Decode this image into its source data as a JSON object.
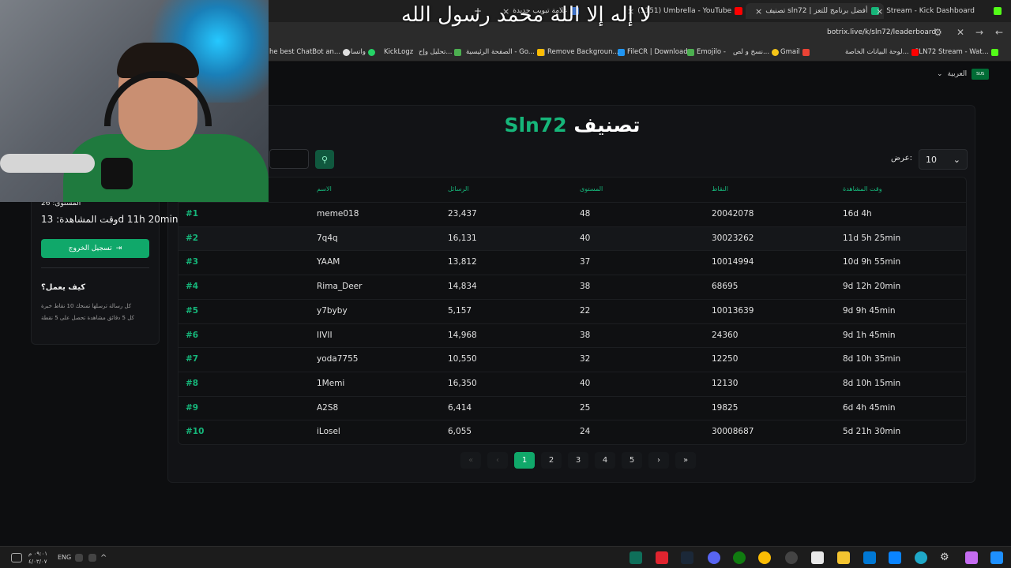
{
  "browser": {
    "tabs": [
      {
        "label": "علامة تبويب جديدة",
        "color": "#4c8bf5"
      },
      {
        "label": "(1151) Umbrella - YouTube",
        "color": "#ff0000"
      },
      {
        "label": "تصنيف sln72 | أفضل برنامج للتعز",
        "color": "#16b67a"
      },
      {
        "label": "Stream - Kick Dashboard",
        "color": "#53fc18"
      }
    ],
    "url": "botrix.live/k/sln72/leaderboard",
    "bookmarks": [
      "SLN72 Stream - Wat...",
      "لوحة البيانات الخاصة...",
      "Gmail",
      "نسخ و لص...",
      "Emojilo -",
      "FileCR | Download",
      "Remove Backgroun...",
      "الصفحة الرئيسية - Go...",
      "تحليل وإح...",
      "KickLogz",
      "واتساب",
      "he best ChatBot an..."
    ]
  },
  "overlay_text": "لا إله إلا الله محمد رسول الله",
  "language": {
    "label": "العربية",
    "flag_text": "SUS"
  },
  "sidebar": {
    "level_line": "المستوى: 26",
    "watch_line": "وقت المشاهدة: 13d 11h 20min",
    "logout_label": "تسجيل الخروج",
    "how_title": "كيف يعمل؟",
    "how_lines": [
      "كل رسالة ترسلها تمنحك 10 نقاط خبرة",
      "كل 5 دقائق مشاهدة تحصل على 5 نقطة"
    ]
  },
  "leaderboard": {
    "title_prefix": "تصنيف",
    "title_brand": "Sln72",
    "search_placeholder": "",
    "show_label": "عرض:",
    "per_page": "10",
    "columns": [
      "الاسم",
      "الرسائل",
      "المستوى",
      "النقاط",
      "وقت المشاهدة"
    ],
    "rows": [
      {
        "rank": "#1",
        "name": "meme018",
        "messages": "23,437",
        "level": "48",
        "points": "20042078",
        "watch": "16d 4h"
      },
      {
        "rank": "#2",
        "name": "7q4q",
        "messages": "16,131",
        "level": "40",
        "points": "30023262",
        "watch": "11d 5h 25min"
      },
      {
        "rank": "#3",
        "name": "YAAM",
        "messages": "13,812",
        "level": "37",
        "points": "10014994",
        "watch": "10d 9h 55min"
      },
      {
        "rank": "#4",
        "name": "Rima_Deer",
        "messages": "14,834",
        "level": "38",
        "points": "68695",
        "watch": "9d 12h 20min"
      },
      {
        "rank": "#5",
        "name": "y7byby",
        "messages": "5,157",
        "level": "22",
        "points": "10013639",
        "watch": "9d 9h 45min"
      },
      {
        "rank": "#6",
        "name": "IIVII",
        "messages": "14,968",
        "level": "38",
        "points": "24360",
        "watch": "9d 1h 45min"
      },
      {
        "rank": "#7",
        "name": "yoda7755",
        "messages": "10,550",
        "level": "32",
        "points": "12250",
        "watch": "8d 10h 35min"
      },
      {
        "rank": "#8",
        "name": "1Memi",
        "messages": "16,350",
        "level": "40",
        "points": "12130",
        "watch": "8d 10h 15min"
      },
      {
        "rank": "#9",
        "name": "A2S8",
        "messages": "6,414",
        "level": "25",
        "points": "19825",
        "watch": "6d 4h 45min"
      },
      {
        "rank": "#10",
        "name": "iLosel",
        "messages": "6,055",
        "level": "24",
        "points": "30008687",
        "watch": "5d 21h 30min"
      }
    ],
    "pagination": {
      "first": "«",
      "prev": "‹",
      "pages": [
        "1",
        "2",
        "3",
        "4",
        "5"
      ],
      "current": "1",
      "next": "›",
      "last": "»"
    }
  },
  "taskbar": {
    "time": "٠٩:٠١ م",
    "date": "٤/٠٣/٠٧",
    "lang": "ENG"
  }
}
